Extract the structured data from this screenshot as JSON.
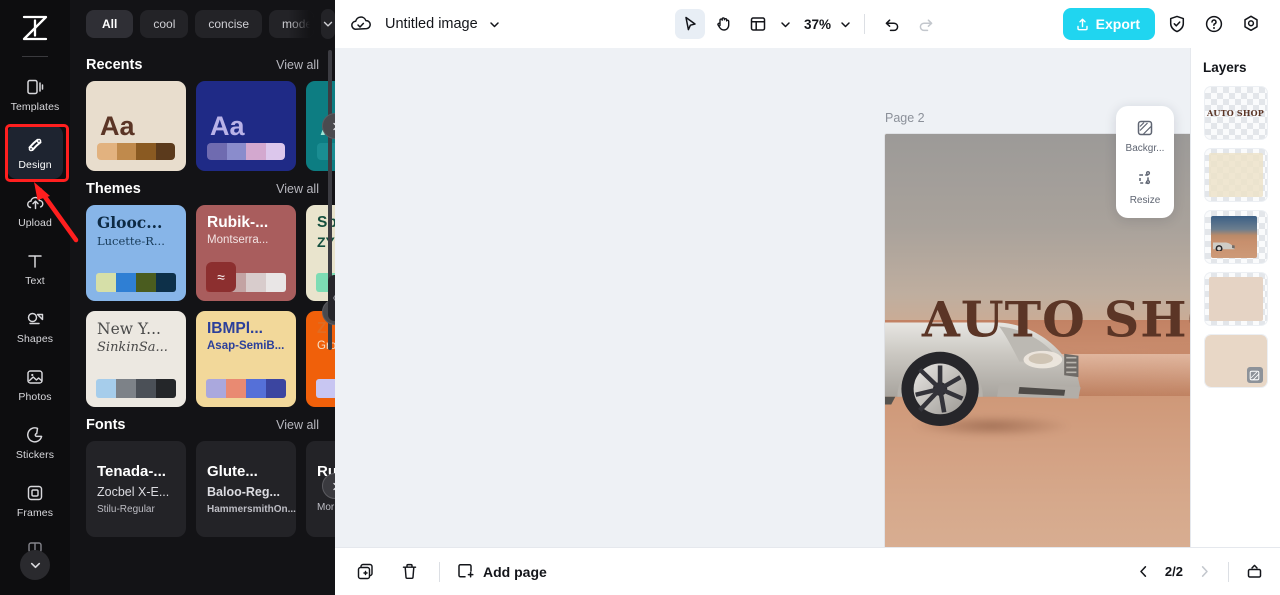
{
  "app": {
    "logo_icon": "capcut-logo-icon"
  },
  "rail": {
    "items": [
      {
        "label": "Templates",
        "icon": "templates-icon",
        "active": false
      },
      {
        "label": "Design",
        "icon": "design-icon",
        "active": true
      },
      {
        "label": "Upload",
        "icon": "upload-cloud-icon",
        "active": false
      },
      {
        "label": "Text",
        "icon": "text-icon",
        "active": false
      },
      {
        "label": "Shapes",
        "icon": "shapes-icon",
        "active": false
      },
      {
        "label": "Photos",
        "icon": "photos-icon",
        "active": false
      },
      {
        "label": "Stickers",
        "icon": "stickers-icon",
        "active": false
      },
      {
        "label": "Frames",
        "icon": "frames-icon",
        "active": false
      }
    ],
    "collapse_icon": "chevron-down-icon"
  },
  "annotation": {
    "highlight_color": "#ff1f1f",
    "target": "Design",
    "arrow_icon": "red-arrow-icon"
  },
  "panel": {
    "chips": [
      {
        "label": "All",
        "active": true
      },
      {
        "label": "cool",
        "active": false
      },
      {
        "label": "concise",
        "active": false
      },
      {
        "label": "modern",
        "active": false
      }
    ],
    "chips_more_icon": "chevron-down-icon",
    "sections": {
      "recents": {
        "title": "Recents",
        "link": "View all",
        "cards": [
          {
            "sample": "Aa",
            "bg": "#e8ddcd",
            "fg": "#5b3526",
            "swatches": [
              "#e2b27f",
              "#c08a4c",
              "#8a5a22",
              "#5b3a1c"
            ]
          },
          {
            "sample": "Aa",
            "bg": "#1f2a86",
            "fg": "#b9b2e8",
            "swatches": [
              "#6f6bb0",
              "#8a8ccc",
              "#d3a8cf",
              "#dcc7ec"
            ]
          },
          {
            "sample": "A",
            "bg": "#0d7d82",
            "fg": "#9fe6d6",
            "swatches": [
              "#1a8d92",
              "#1a8d92",
              "#1a8d92",
              "#1a8d92"
            ]
          }
        ]
      },
      "themes": {
        "title": "Themes",
        "link": "View all",
        "cards": [
          {
            "line1": "Glooc...",
            "line2": "Lucette-R...",
            "bg": "#87b5e8",
            "fg": "#0d2a44",
            "fg2": "#173a58",
            "serif": true,
            "swatches": [
              "#d6dfa8",
              "#2f7fd4",
              "#4a5c1f",
              "#0d3049"
            ]
          },
          {
            "line1": "Rubik-...",
            "line2": "Montserra...",
            "bg": "#a95d5d",
            "fg": "#ffffff",
            "fg2": "#f2e3e3",
            "serif": false,
            "swatches": [
              "#9c3434",
              "#c3a3a3",
              "#d8cccc",
              "#e9e6e6"
            ],
            "badge": "≈",
            "badge_bg": "#8c2f2f"
          },
          {
            "line1": "Sp",
            "line2": "ZY",
            "bg": "#e9e4cd",
            "fg": "#15503f",
            "fg2": "#15503f",
            "serif": false,
            "swatches": [
              "#7ddcb4",
              "#7ddcb4",
              "#7ddcb4",
              "#7ddcb4"
            ]
          },
          {
            "line1": "New Y...",
            "line2": "SinkinSa...",
            "bg": "#ece8e1",
            "fg": "#4a4a4a",
            "fg2": "#4a4a4a",
            "serif": true,
            "swatches": [
              "#a6cdeb",
              "#7d8288",
              "#4b5057",
              "#242629"
            ]
          },
          {
            "line1": "IBMPl...",
            "line2": "Asap-SemiB...",
            "bg": "#f2d89a",
            "fg": "#2b3f9b",
            "fg2": "#2b3f9b",
            "serif": false,
            "swatches": [
              "#aaa8dd",
              "#e98a72",
              "#5570d8",
              "#3b45a0"
            ]
          },
          {
            "line1": "Z",
            "line2": "Gro",
            "bg": "#f0600a",
            "fg": "#e06c22",
            "fg2": "#f5e0c8",
            "serif": false,
            "swatches": [
              "#c8c6f2",
              "#c8c6f2",
              "#c8c6f2",
              "#c8c6f2"
            ]
          }
        ]
      },
      "fonts": {
        "title": "Fonts",
        "link": "View all",
        "cards": [
          {
            "l1": "Tenada-...",
            "l2": "Zocbel X-E...",
            "l3": "Stilu-Regular"
          },
          {
            "l1": "Glute...",
            "l2": "Baloo-Reg...",
            "l3": "HammersmithOn..."
          },
          {
            "l1": "Ru",
            "l2": "",
            "l3": "Mor"
          }
        ]
      }
    },
    "carousel_next_icon": "chevron-right-icon",
    "collapse_handle_icon": "chevron-left-icon"
  },
  "topbar": {
    "cloud_icon": "cloud-saved-icon",
    "doc_title": "Untitled image",
    "doc_menu_icon": "chevron-down-icon",
    "tools": [
      {
        "name": "select-tool",
        "icon": "cursor-icon",
        "selected": true
      },
      {
        "name": "hand-tool",
        "icon": "hand-icon",
        "selected": false
      },
      {
        "name": "layout-tool",
        "icon": "layout-icon",
        "selected": false
      }
    ],
    "layout_menu_icon": "chevron-down-icon",
    "zoom_level": "37%",
    "zoom_menu_icon": "chevron-down-icon",
    "undo_icon": "undo-icon",
    "redo_icon": "redo-icon",
    "export_label": "Export",
    "export_icon": "export-upload-icon",
    "export_color": "#20d5f0",
    "shield_icon": "shield-check-icon",
    "help_icon": "question-circle-icon",
    "settings_icon": "gear-icon"
  },
  "canvas": {
    "page_label": "Page 2",
    "duplicate_page_icon": "duplicate-icon",
    "more_options_icon": "ellipsis-icon",
    "artwork_text": "AUTO SHOP",
    "artwork_text_color": "#5b3526"
  },
  "float_panel": {
    "items": [
      {
        "label": "Backgr...",
        "icon": "background-icon"
      },
      {
        "label": "Resize",
        "icon": "resize-icon"
      }
    ]
  },
  "layers": {
    "title": "Layers",
    "items": [
      {
        "name": "layer-auto-shop-text",
        "type": "text",
        "text": "AUTO SHOP"
      },
      {
        "name": "layer-cream-overlay",
        "type": "fill",
        "color": "#ece2c9"
      },
      {
        "name": "layer-car-photo",
        "type": "image"
      },
      {
        "name": "layer-beige-shape",
        "type": "fill",
        "color": "#e5d3c4"
      },
      {
        "name": "layer-background",
        "type": "background",
        "color": "#e8d7c6",
        "badge_icon": "background-icon"
      }
    ]
  },
  "bottombar": {
    "duplicate_icon": "duplicate-page-icon",
    "delete_icon": "trash-icon",
    "add_page_label": "Add page",
    "add_page_icon": "add-page-icon",
    "prev_icon": "chevron-left-icon",
    "page_indicator": "2/2",
    "next_icon": "chevron-right-icon",
    "panel_toggle_icon": "panel-toggle-icon"
  }
}
